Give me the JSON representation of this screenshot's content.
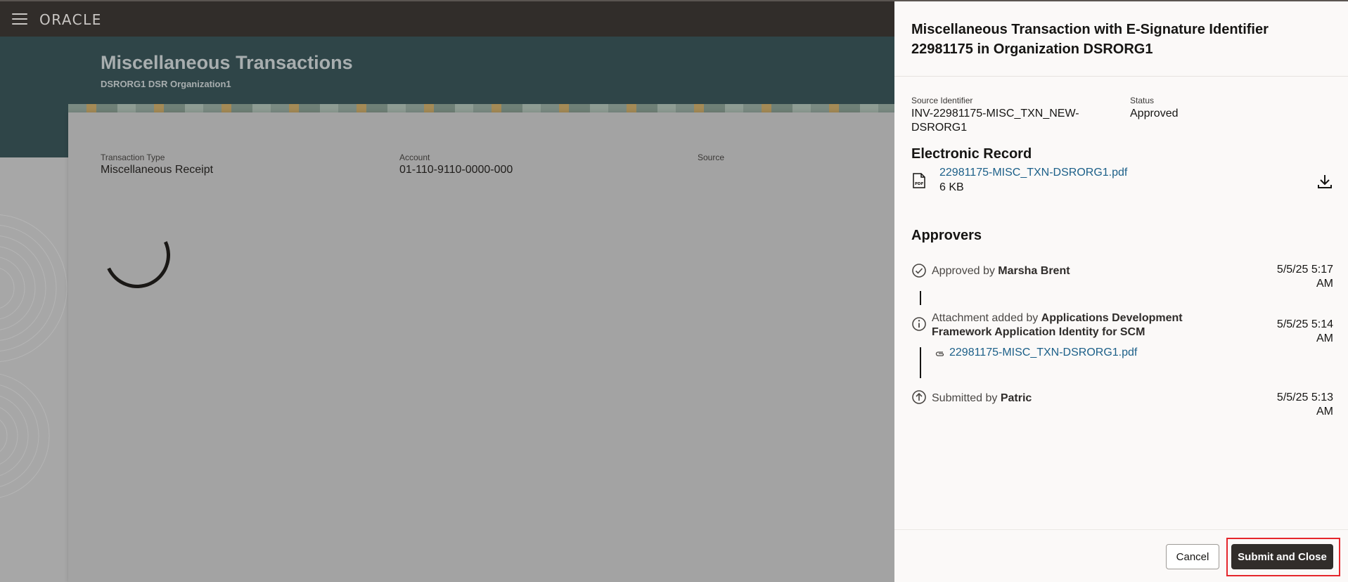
{
  "header": {
    "logo_text": "ORACLE"
  },
  "page": {
    "title": "Miscellaneous Transactions",
    "subtitle": "DSRORG1 DSR Organization1"
  },
  "form": {
    "transaction_type_label": "Transaction Type",
    "transaction_type_value": "Miscellaneous Receipt",
    "account_label": "Account",
    "account_value": "01-110-9110-0000-000",
    "source_label": "Source"
  },
  "drawer": {
    "title_line1": "Miscellaneous Transaction with E-Signature Identifier",
    "title_line2": "22981175 in Organization DSRORG1",
    "source_identifier_label": "Source Identifier",
    "source_identifier_line1": "INV-22981175-MISC_TXN_NEW-",
    "source_identifier_line2": "DSRORG1",
    "status_label": "Status",
    "status_value": "Approved",
    "electronic_record_title": "Electronic Record",
    "record_file_name": "22981175-MISC_TXN-DSRORG1.pdf",
    "record_file_size": "6 KB",
    "approvers_title": "Approvers",
    "events": [
      {
        "action": "Approved by",
        "actor": "Marsha Brent",
        "time_line1": "5/5/25 5:17",
        "time_line2": "AM",
        "icon": "check-circle-icon"
      },
      {
        "action": "Attachment added by",
        "actor_line1": "Applications Development",
        "actor_line2": "Framework Application Identity for SCM",
        "time_line1": "5/5/25 5:14",
        "time_line2": "AM",
        "attachment": "22981175-MISC_TXN-DSRORG1.pdf",
        "icon": "info-circle-icon"
      },
      {
        "action": "Submitted by",
        "actor": "Patric",
        "time_line1": "5/5/25 5:13",
        "time_line2": "AM",
        "icon": "arrow-up-circle-icon"
      }
    ],
    "cancel_label": "Cancel",
    "submit_label": "Submit and Close"
  },
  "colors": {
    "topbar": "#312d2a",
    "hero": "#2f4548",
    "link": "#1b5f88",
    "primary_button": "#312d2a",
    "focus_ring": "#e5262c"
  }
}
